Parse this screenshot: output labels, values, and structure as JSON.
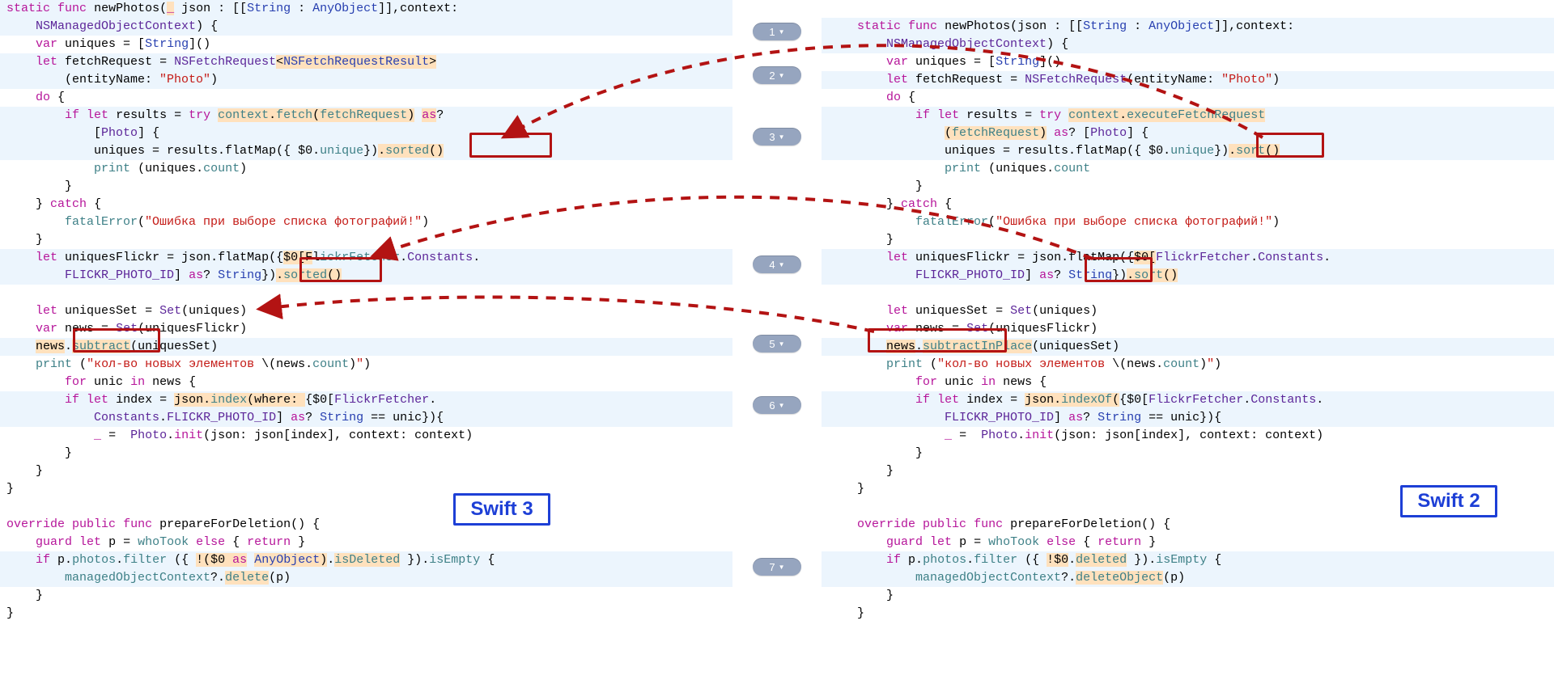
{
  "markers": [
    "1",
    "2",
    "3",
    "4",
    "5",
    "6",
    "7"
  ],
  "left_label": "Swift 3",
  "right_label": "Swift 2",
  "left": {
    "l0": "static func newPhotos(_ json : [[String : AnyObject]],context:",
    "l1": "    NSManagedObjectContext) {",
    "l2": "    var uniques = [String]()",
    "l3": "    let fetchRequest = NSFetchRequest<NSFetchRequestResult>",
    "l4": "        (entityName: \"Photo\")",
    "l5": "    do {",
    "l6": "        if let results = try context.fetch(fetchRequest) as?",
    "l7": "            [Photo] {",
    "l8": "            uniques = results.flatMap({ $0.unique}).sorted()",
    "l9": "            print (uniques.count)",
    "l10": "        }",
    "l11": "    } catch {",
    "l12": "        fatalError(\"Ошибка при выборе списка фотографий!\")",
    "l13": "    }",
    "l14": "    let uniquesFlickr = json.flatMap({$0[FlickrFetcher.Constants.",
    "l15": "        FLICKR_PHOTO_ID] as? String}).sorted()",
    "l16": "",
    "l17": "    let uniquesSet = Set(uniques)",
    "l18": "    var news = Set(uniquesFlickr)",
    "l19": "    news.subtract(uniquesSet)",
    "l20": "    print (\"кол-во новых элементов \\(news.count)\")",
    "l21": "        for unic in news {",
    "l22": "        if let index = json.index(where: {$0[FlickrFetcher.",
    "l23": "            Constants.FLICKR_PHOTO_ID] as? String == unic}){",
    "l24": "            _ =  Photo.init(json: json[index], context: context)",
    "l25": "        }",
    "l26": "    }",
    "l27": "}",
    "l28": "",
    "l29": "override public func prepareForDeletion() {",
    "l30": "    guard let p = whoTook else { return }",
    "l31": "    if p.photos.filter ({ !($0 as AnyObject).isDeleted }).isEmpty {",
    "l32": "        managedObjectContext?.delete(p)",
    "l33": "    }",
    "l34": "}"
  },
  "right": {
    "l0": "",
    "l1": "    static func newPhotos(json : [[String : AnyObject]],context:",
    "l2": "        NSManagedObjectContext) {",
    "l3": "        var uniques = [String]()",
    "l4": "        let fetchRequest = NSFetchRequest(entityName: \"Photo\")",
    "l5": "        do {",
    "l6": "            if let results = try context.executeFetchRequest",
    "l7": "                (fetchRequest) as? [Photo] {",
    "l8": "                uniques = results.flatMap({ $0.unique}).sort()",
    "l9": "                print (uniques.count",
    "l10": "            }",
    "l11": "        } catch {",
    "l12": "            fatalError(\"Ошибка при выборе списка фотографий!\")",
    "l13": "        }",
    "l14": "        let uniquesFlickr = json.flatMap({$0[FlickrFetcher.Constants.",
    "l15": "            FLICKR_PHOTO_ID] as? String}).sort()",
    "l16": "",
    "l17": "        let uniquesSet = Set(uniques)",
    "l18": "        var news = Set(uniquesFlickr)",
    "l19": "        news.subtractInPlace(uniquesSet)",
    "l20": "        print (\"кол-во новых элементов \\(news.count)\")",
    "l21": "            for unic in news {",
    "l22": "            if let index = json.indexOf({$0[FlickrFetcher.Constants.",
    "l23": "                FLICKR_PHOTO_ID] as? String == unic}){",
    "l24": "                _ =  Photo.init(json: json[index], context: context)",
    "l25": "            }",
    "l26": "        }",
    "l27": "    }",
    "l28": "",
    "l29": "    override public func prepareForDeletion() {",
    "l30": "        guard let p = whoTook else { return }",
    "l31": "        if p.photos.filter ({ !$0.deleted }).isEmpty {",
    "l32": "            managedObjectContext?.deleteObject(p)",
    "l33": "        }",
    "l34": "    }"
  }
}
